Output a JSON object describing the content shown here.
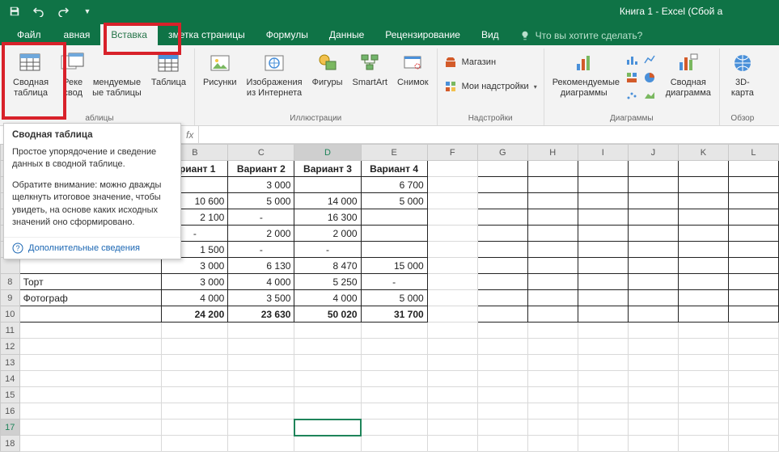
{
  "titlebar": {
    "title": "Книга 1 - Excel (Сбой а"
  },
  "tabs": {
    "file": "Файл",
    "home": "авная",
    "insert": "Вставка",
    "layout": "зметка страницы",
    "formulas": "Формулы",
    "data": "Данные",
    "review": "Рецензирование",
    "view": "Вид",
    "tellme_placeholder": "Что вы хотите сделать?"
  },
  "ribbon": {
    "groups": {
      "tables": {
        "label": "аблицы",
        "pivot": "Сводная\nтаблица",
        "recommended_pivot": "мендуемые\nые таблицы",
        "table": "Таблица",
        "rec_prefix": "Реке\nсвод"
      },
      "illustrations": {
        "label": "Иллюстрации",
        "pictures": "Рисунки",
        "online_pictures": "Изображения\nиз Интернета",
        "shapes": "Фигуры",
        "smartart": "SmartArt",
        "screenshot": "Снимок"
      },
      "addins": {
        "label": "Надстройки",
        "store": "Магазин",
        "myaddins": "Мои надстройки"
      },
      "charts": {
        "label": "Диаграммы",
        "recommended": "Рекомендуемые\nдиаграммы",
        "pivotchart": "Сводная\nдиаграмма"
      },
      "tours": {
        "label": "Обзор",
        "map3d": "3D-\nкарта"
      }
    }
  },
  "tooltip": {
    "title": "Сводная таблица",
    "body1": "Простое упорядочение и сведение данных в сводной таблице.",
    "body2": "Обратите внимание: можно дважды щелкнуть итоговое значение, чтобы увидеть, на основе каких исходных значений оно сформировано.",
    "link": "Дополнительные сведения"
  },
  "formula_bar": {
    "fx": "fx"
  },
  "columns": [
    "",
    "B",
    "C",
    "D",
    "E",
    "F",
    "G",
    "H",
    "I",
    "J",
    "K",
    "L"
  ],
  "row_headers": [
    "",
    "",
    "",
    "",
    "",
    "",
    "",
    "8",
    "9",
    "10",
    "11",
    "12",
    "13",
    "14",
    "15",
    "16",
    "17",
    "18"
  ],
  "table": {
    "headers": [
      "ариант 1",
      "Вариант 2",
      "Вариант 3",
      "Вариант 4"
    ],
    "rows": [
      {
        "a": "",
        "cells": [
          "",
          "3 000",
          "",
          "6 700"
        ]
      },
      {
        "a": "",
        "cells": [
          "10 600",
          "5 000",
          "14 000",
          "5 000"
        ]
      },
      {
        "a": "",
        "cells": [
          "2 100",
          "-",
          "16 300",
          ""
        ]
      },
      {
        "a": "",
        "cells": [
          "-",
          "2 000",
          "2 000",
          ""
        ]
      },
      {
        "a": "",
        "cells": [
          "1 500",
          "-",
          "-",
          ""
        ]
      },
      {
        "a": "",
        "cells": [
          "3 000",
          "6 130",
          "8 470",
          "15 000"
        ]
      },
      {
        "a": "Торт",
        "cells": [
          "3 000",
          "4 000",
          "5 250",
          "-"
        ]
      },
      {
        "a": "Фотограф",
        "cells": [
          "4 000",
          "3 500",
          "4 000",
          "5 000"
        ]
      }
    ],
    "total": {
      "a": "",
      "cells": [
        "24 200",
        "23 630",
        "50 020",
        "31 700"
      ]
    }
  }
}
